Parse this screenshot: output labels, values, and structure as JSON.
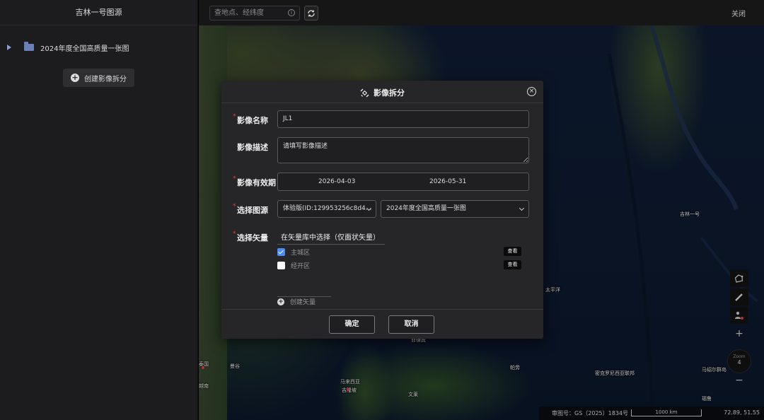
{
  "sidebar": {
    "title": "吉林一号图源",
    "tree_item_label": "2024年度全国高质量一张图",
    "create_button_label": "创建影像拆分"
  },
  "topbar": {
    "search_placeholder": "查地点、经纬度",
    "close_label": "关闭"
  },
  "map": {
    "labels": [
      "吉林一号",
      "太平洋",
      "曼谷",
      "马来西亚",
      "文莱",
      "吉隆坡",
      "帕劳",
      "密克罗尼西亚联邦",
      "马绍尔群岛",
      "瑙鲁",
      "菲律宾",
      "越南",
      "泰国"
    ],
    "zoom_label": "Zoom",
    "zoom_value": "4",
    "approval": "审图号：GS（2025）1834号",
    "scale": "1000 km",
    "coords": "72.89, 51.55"
  },
  "dialog": {
    "title": "影像拆分",
    "fields": {
      "name_label": "影像名称",
      "name_value": "JL1",
      "desc_label": "影像描述",
      "desc_placeholder": "请填写影像描述",
      "validity_label": "影像有效期",
      "date_start": "2026-04-03",
      "date_end": "2026-05-31",
      "source_label": "选择图源",
      "source_version": "体验版(ID:129953256c8d4...",
      "source_layer": "2024年度全国高质量一张图",
      "vector_label": "选择矢量"
    },
    "vector_tab": "在矢量库中选择（仅面状矢量）",
    "vectors": [
      {
        "name": "主城区",
        "checked": true,
        "action": "查看"
      },
      {
        "name": "经开区",
        "checked": false,
        "action": "查看"
      }
    ],
    "create_vector_label": "创建矢量",
    "confirm_label": "确定",
    "cancel_label": "取消"
  },
  "colors": {
    "accent": "#4a8bf5",
    "required": "#e04040",
    "panel": "#262628",
    "sidebar": "#1c1c1e"
  }
}
